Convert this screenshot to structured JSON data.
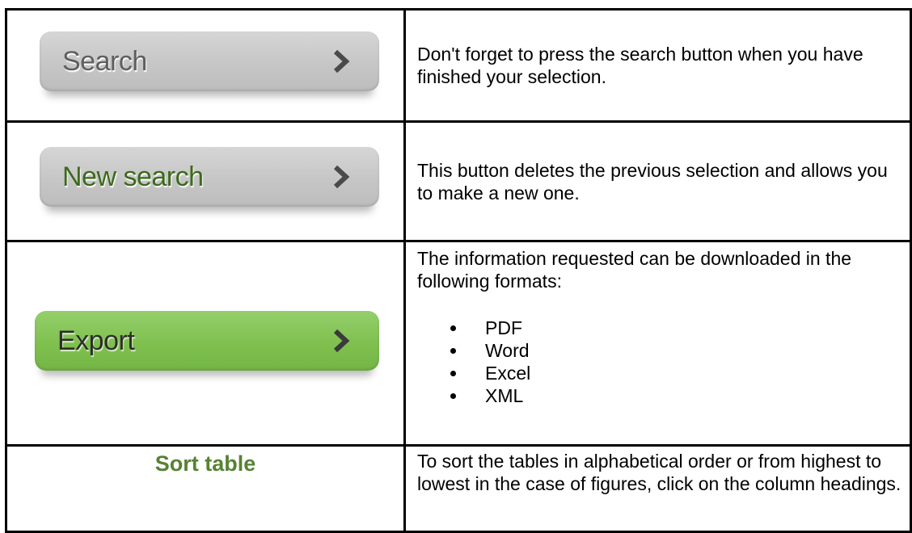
{
  "rows": [
    {
      "button_label": "Search",
      "description": "Don't forget to press the search button when you have finished your selection."
    },
    {
      "button_label": "New search",
      "description": "This button deletes the previous selection and allows you to make a new one."
    },
    {
      "button_label": "Export",
      "description": "The information requested can be downloaded in the following formats:",
      "formats": [
        "PDF",
        "Word",
        "Excel",
        "XML"
      ]
    },
    {
      "label": "Sort table",
      "description": "To sort the tables in alphabetical order or from highest to lowest in the case of figures, click on the column headings."
    }
  ],
  "colors": {
    "grey_button": "#c6c6c6",
    "green_button": "#7fc04f",
    "green_text": "#568232",
    "border": "#000000"
  },
  "icons": {
    "button_arrow": "chevron-right-icon"
  }
}
